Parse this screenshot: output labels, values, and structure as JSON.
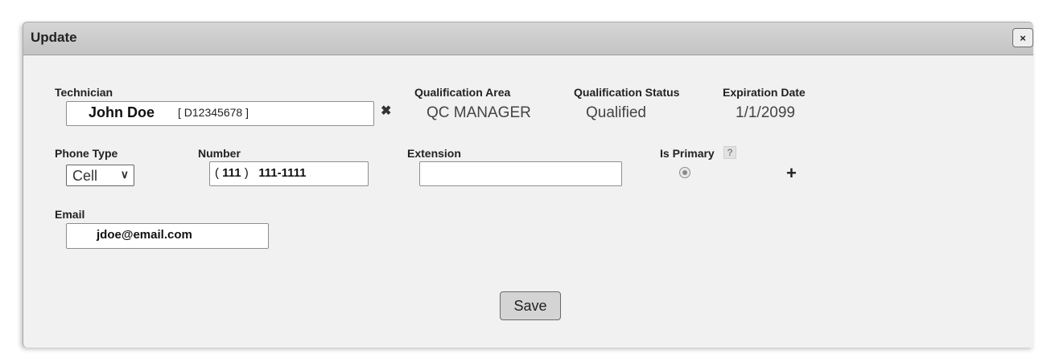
{
  "dialog": {
    "title": "Update",
    "close_icon": "×"
  },
  "technician": {
    "label": "Technician",
    "name": "John Doe",
    "id_display": "[  D12345678   ]",
    "clear_icon": "✖"
  },
  "qualification": {
    "area_label": "Qualification Area",
    "area_value": "QC MANAGER",
    "status_label": "Qualification Status",
    "status_value": "Qualified",
    "expiration_label": "Expiration Date",
    "expiration_value": "1/1/2099"
  },
  "phone": {
    "type_label": "Phone Type",
    "type_value": "Cell",
    "number_label": "Number",
    "area_code_open": "( ",
    "area_code": "111",
    "area_code_close": " )",
    "number_value": "111-1111",
    "extension_label": "Extension",
    "extension_value": "",
    "is_primary_label": "Is Primary",
    "help_icon": "?",
    "add_icon": "+"
  },
  "email": {
    "label": "Email",
    "value": "jdoe@email.com"
  },
  "actions": {
    "save_label": "Save"
  }
}
